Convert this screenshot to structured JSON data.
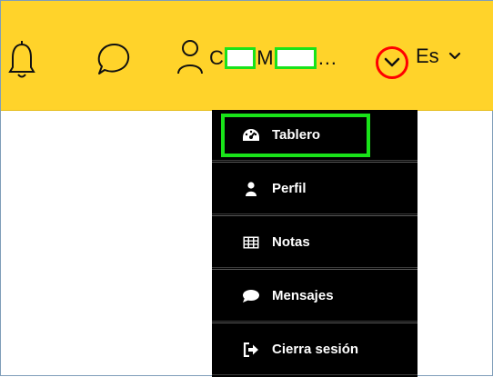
{
  "header": {
    "background": "#ffd32a",
    "notifications_icon": "bell-icon",
    "messages_icon": "chat-bubble-icon",
    "user_icon": "user-icon",
    "username_prefix": "C",
    "username_middle": "M",
    "username_suffix": "…",
    "dropdown_icon": "chevron-down-circle-icon",
    "language_label": "Es",
    "language_icon": "chevron-down-icon"
  },
  "menu": {
    "items": [
      {
        "label": "Tablero",
        "icon": "dashboard-gauge-icon"
      },
      {
        "label": "Perfil",
        "icon": "user-icon"
      },
      {
        "label": "Notas",
        "icon": "table-grid-icon"
      },
      {
        "label": "Mensajes",
        "icon": "speech-bubble-icon"
      },
      {
        "label": "Cierra sesión",
        "icon": "sign-out-icon"
      }
    ]
  },
  "annotation_colors": {
    "highlight": "#19e319",
    "circle": "#ff0000"
  }
}
